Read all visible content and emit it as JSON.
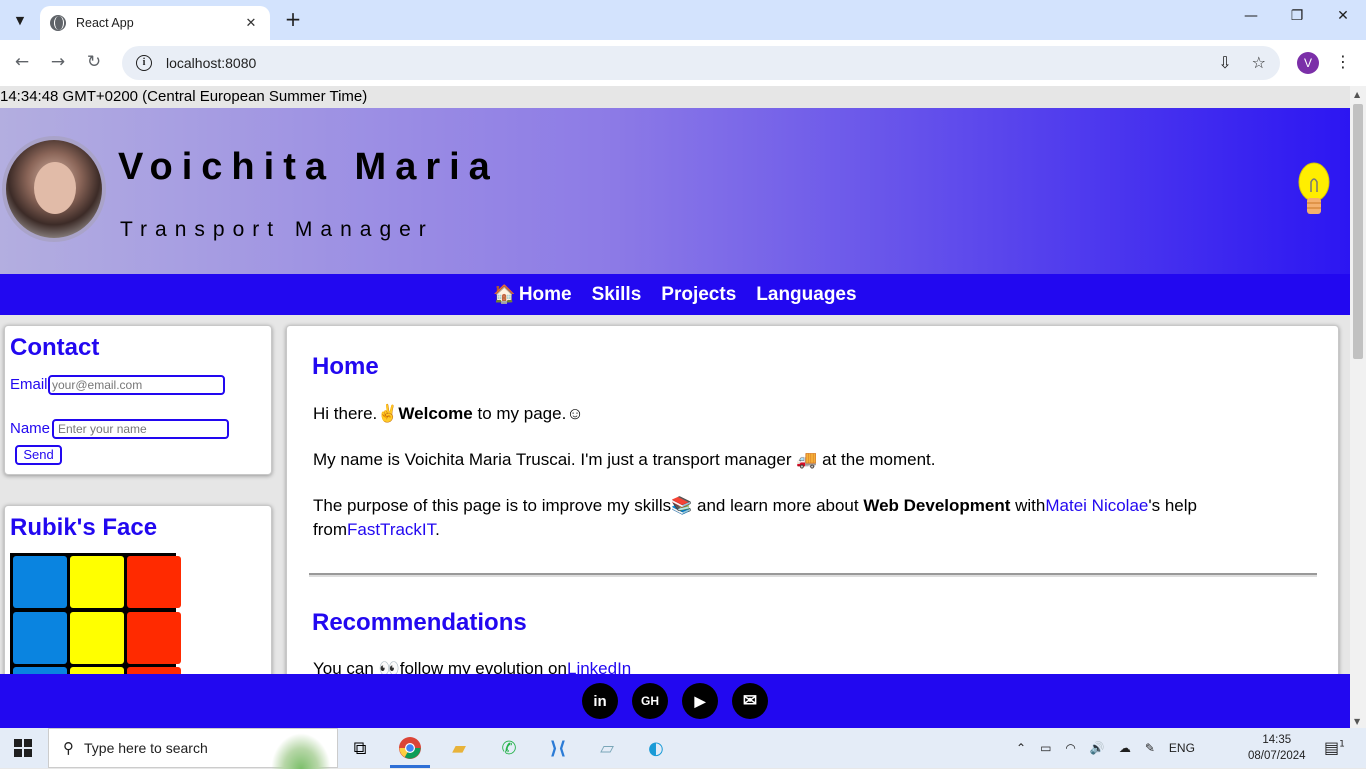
{
  "browser": {
    "tab_title": "React App",
    "url": "localhost:8080",
    "profile_initial": "V"
  },
  "page": {
    "time_text": "14:34:48 GMT+0200 (Central European Summer Time)",
    "header": {
      "name": "Voichita Maria",
      "role": "Transport Manager"
    },
    "nav": {
      "home": "Home",
      "skills": "Skills",
      "projects": "Projects",
      "languages": "Languages"
    },
    "contact": {
      "title": "Contact",
      "email_label": "Email",
      "email_placeholder": "your@email.com",
      "name_label": "Name",
      "name_placeholder": "Enter your name",
      "send_label": "Send"
    },
    "rubik": {
      "title": "Rubik's Face",
      "colors": [
        "#0a84e0",
        "#ffff00",
        "#ff2a00",
        "#0a84e0",
        "#ffff00",
        "#ff2a00",
        "#0a84e0",
        "#ffff00",
        "#ff2a00"
      ]
    },
    "home": {
      "title": "Home",
      "p1_pre": "Hi there.",
      "p1_bold": "Welcome",
      "p1_post": " to my page.",
      "p2": "My name is Voichita Maria Truscai. I'm just a transport manager ",
      "p2_post": " at the moment.",
      "p3_pre": "The purpose of this page is to improve my skills",
      "p3_mid": " and learn more about ",
      "p3_bold": "Web Development",
      "p3_with": " with",
      "p3_link1": "Matei Nicolae",
      "p3_help": "'s help",
      "p3_from": "from",
      "p3_link2": "FastTrackIT",
      "p3_end": "."
    },
    "recommendations": {
      "title": "Recommendations",
      "text_pre": "You can ",
      "text_mid": "follow my evolution on",
      "link": "LinkedIn"
    },
    "footer": {
      "linkedin": "in",
      "github": "GH",
      "youtube": "▶",
      "email": "✉"
    }
  },
  "taskbar": {
    "search_placeholder": "Type here to search",
    "language": "ENG",
    "time": "14:35",
    "date": "08/07/2024",
    "notification_count": "1"
  }
}
